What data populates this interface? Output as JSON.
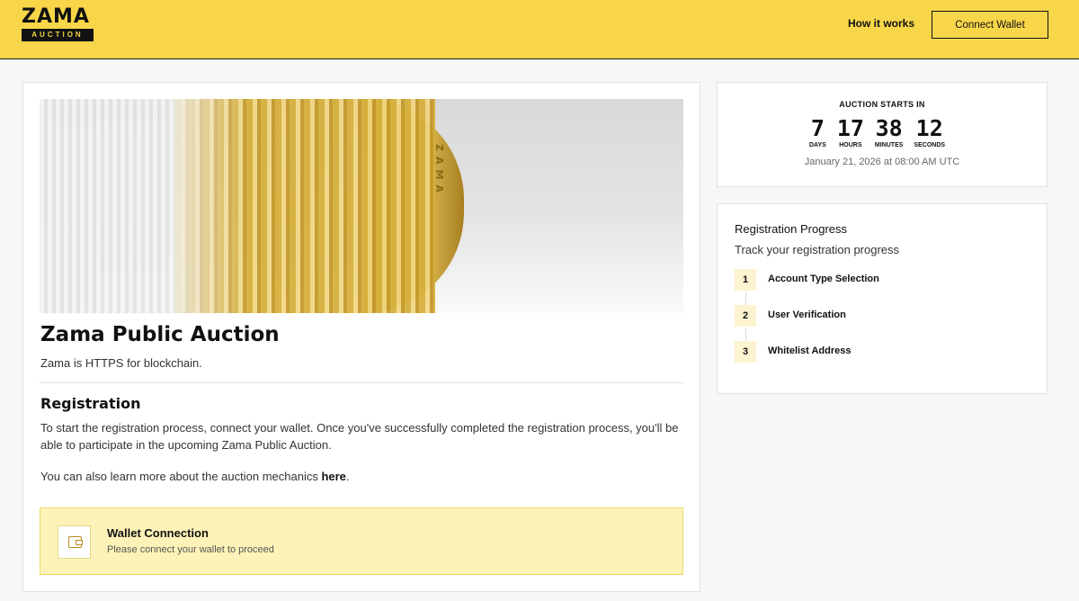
{
  "header": {
    "logo_word": "ZAMA",
    "logo_sub": "AUCTION",
    "nav_how": "How it works",
    "connect_button": "Connect Wallet",
    "bg_color": "#f8d64a"
  },
  "hero": {
    "coin_text": "ZAMA"
  },
  "main": {
    "title": "Zama Public Auction",
    "subtitle": "Zama is HTTPS for blockchain.",
    "registration_title": "Registration",
    "registration_text": "To start the registration process, connect your wallet. Once you've successfully completed the registration process, you'll be able to participate in the upcoming Zama Public Auction.",
    "learn_prefix": "You can also learn more about the auction mechanics ",
    "learn_link": "here",
    "learn_suffix": ".",
    "wallet": {
      "title": "Wallet Connection",
      "subtitle": "Please connect your wallet to proceed",
      "icon": "wallet-icon"
    }
  },
  "countdown": {
    "label": "AUCTION STARTS IN",
    "units": [
      {
        "value": "7",
        "label": "DAYS"
      },
      {
        "value": "17",
        "label": "HOURS"
      },
      {
        "value": "38",
        "label": "MINUTES"
      },
      {
        "value": "12",
        "label": "SECONDS"
      }
    ],
    "date": "January 21, 2026 at 08:00 AM UTC"
  },
  "progress": {
    "title": "Registration Progress",
    "subtitle": "Track your registration progress",
    "steps": [
      {
        "num": "1",
        "label": "Account Type Selection"
      },
      {
        "num": "2",
        "label": "User Verification"
      },
      {
        "num": "3",
        "label": "Whitelist Address"
      }
    ]
  }
}
